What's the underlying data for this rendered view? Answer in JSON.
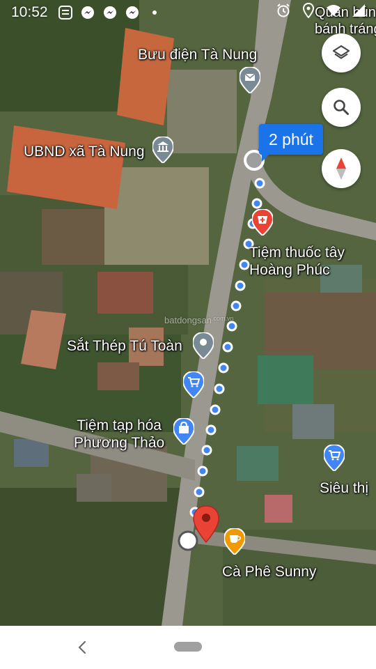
{
  "status_bar": {
    "time": "10:52",
    "left_icons": [
      "bao-moi-icon",
      "messenger-icon",
      "messenger-icon",
      "messenger-icon",
      "dot-icon"
    ],
    "right_icons": [
      "alarm-icon",
      "location-icon",
      "wifi-icon",
      "signal-icon"
    ],
    "overflow_text_1": "Quán bún",
    "overflow_text_2": "bánh tráng"
  },
  "eta": {
    "label": "2 phút"
  },
  "labels": {
    "buu_dien": "Bưu điện Tà Nung",
    "ubnd": "UBND xã Tà Nung",
    "tiem_thuoc_line1": "Tiệm thuốc tây",
    "tiem_thuoc_line2": "Hoàng Phúc",
    "sat_thep": "Sắt Thép Tú Toàn",
    "tap_hoa_line1": "Tiệm tạp hóa",
    "tap_hoa_line2": "Phương Thảo",
    "sieu_thi": "Siêu thị",
    "ca_phe": "Cà Phê Sunny",
    "watermark": "batdongsan",
    "watermark_suffix": ".com.vn"
  },
  "buttons": {
    "layers": "layers-icon",
    "search": "search-icon",
    "compass": "compass-icon"
  },
  "colors": {
    "route_blue": "#1a73e8",
    "poi_gray": "#7a8a94",
    "poi_blue": "#4285f4",
    "poi_red": "#ea4335",
    "poi_orange": "#f29900",
    "destination_red": "#ea4335"
  },
  "nav": {
    "back": "back-icon",
    "home": "home-pill"
  }
}
